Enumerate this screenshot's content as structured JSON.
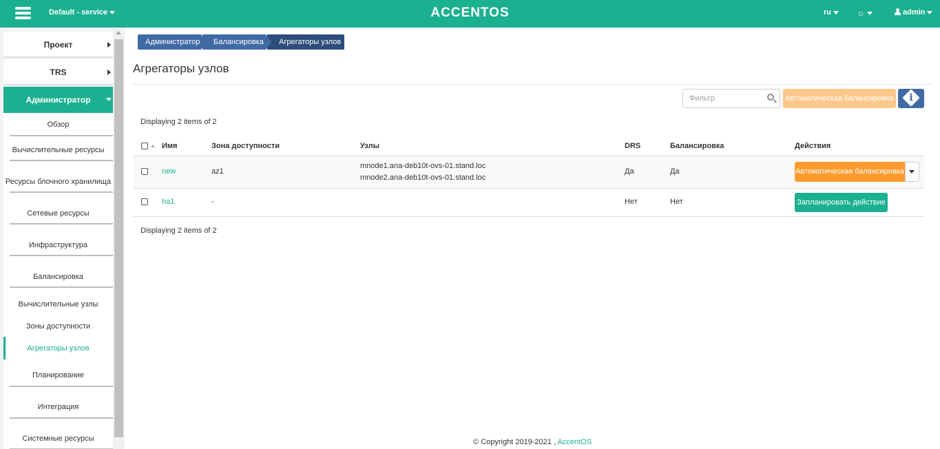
{
  "topbar": {
    "project": "Default - service",
    "logo": "ACCENTOS",
    "lang": "ru",
    "user": "admin"
  },
  "sidebar": {
    "top_items": [
      {
        "label": "Проект"
      },
      {
        "label": "TRS"
      }
    ],
    "admin_label": "Администратор",
    "sections": [
      {
        "label": "Обзор"
      },
      {
        "label": "Вычислительные ресурсы"
      },
      {
        "label": "Ресурсы блочного хранилища"
      },
      {
        "label": "Сетевые ресурсы"
      },
      {
        "label": "Инфраструктура"
      },
      {
        "label": "Балансировка"
      }
    ],
    "balancing_children": [
      {
        "label": "Вычислительные узлы"
      },
      {
        "label": "Зоны доступности"
      },
      {
        "label": "Агрегаторы узлов"
      }
    ],
    "more_sections": [
      {
        "label": "Планирование"
      },
      {
        "label": "Интеграция"
      },
      {
        "label": "Системные ресурсы"
      }
    ]
  },
  "breadcrumb": [
    "Администратор",
    "Балансировка",
    "Агрегаторы узлов"
  ],
  "page_title": "Агрегаторы узлов",
  "toolbar": {
    "filter_placeholder": "Фильтр",
    "auto_balance_label": "Автоматическая балансировка"
  },
  "table": {
    "count_text": "Displaying 2 items of 2",
    "columns": [
      "Имя",
      "Зона доступности",
      "Узлы",
      "DRS",
      "Балансировка",
      "Действия"
    ],
    "rows": [
      {
        "name": "new",
        "zone": "az1",
        "nodes": [
          "mnode1.ana-deb10t-ovs-01.stand.loc",
          "mnode2.ana-deb10t-ovs-01.stand.loc"
        ],
        "drs": "Да",
        "balancing": "Да",
        "action": "Автоматическая балансировка"
      },
      {
        "name": "ha1",
        "zone": "-",
        "nodes": [],
        "drs": "Нет",
        "balancing": "Нет",
        "action": "Запланировать действие"
      }
    ]
  },
  "footer": {
    "copyright": "© Copyright 2019-2021 ,",
    "brand": "AccentOS"
  },
  "colors": {
    "accent": "#1bb08f",
    "breadcrumb": "#3f6aa4",
    "orange": "#fd9b2e"
  }
}
